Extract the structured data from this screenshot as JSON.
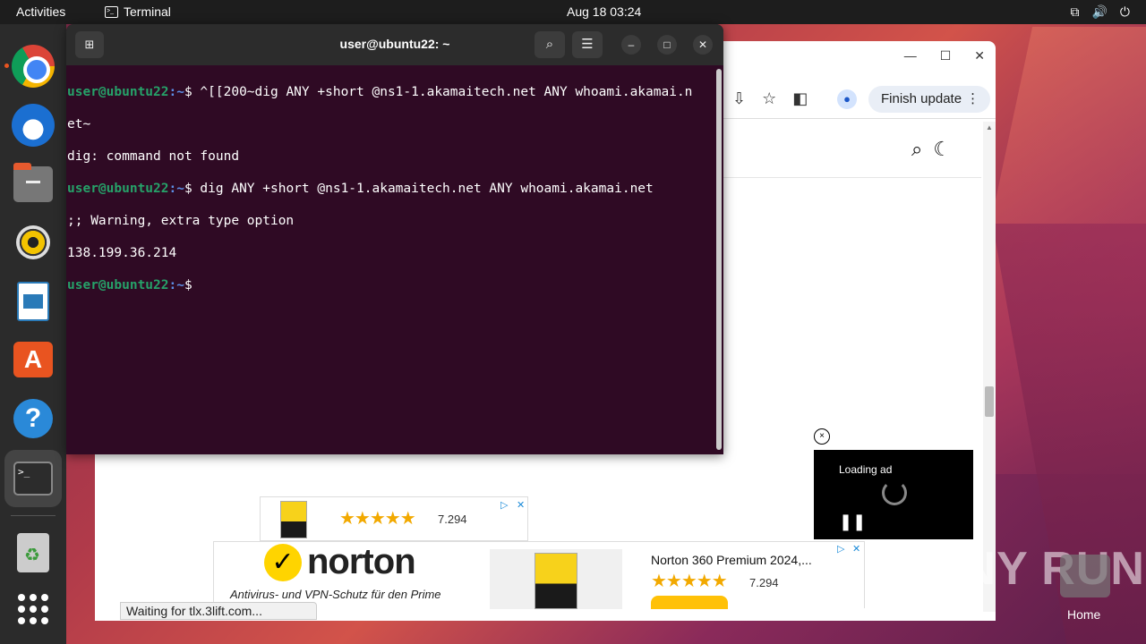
{
  "topbar": {
    "activities": "Activities",
    "app_name": "Terminal",
    "clock": "Aug 18  03:24",
    "tray": {
      "network": "⧉",
      "volume": "🔊",
      "power": "⏻"
    }
  },
  "dock": {
    "items": [
      "chrome",
      "thunderbird",
      "files",
      "rhythmbox",
      "libreoffice-writer",
      "app-center",
      "help",
      "terminal",
      "trash",
      "show-apps"
    ],
    "terminal_glyph": ">_"
  },
  "terminal": {
    "title": "user@ubuntu22: ~",
    "lines": [
      {
        "user": "user@ubuntu22",
        "path": ":~",
        "cmd": "$ ^[[200~dig ANY +short @ns1-1.akamaitech.net ANY whoami.akamai.n"
      },
      {
        "text": "et~"
      },
      {
        "text": "dig: command not found"
      },
      {
        "user": "user@ubuntu22",
        "path": ":~",
        "cmd": "$ dig ANY +short @ns1-1.akamaitech.net ANY whoami.akamai.net"
      },
      {
        "text": ";; Warning, extra type option"
      },
      {
        "text": "138.199.36.214"
      },
      {
        "user": "user@ubuntu22",
        "path": ":~",
        "cmd": "$ "
      }
    ]
  },
  "browser": {
    "finish_update": "Finish update",
    "status": "Waiting for tlx.3lift.com...",
    "video_ad": {
      "loading": "Loading ad"
    },
    "small_ad": {
      "rating": "7.294"
    },
    "large_ad": {
      "brand": "norton",
      "tagline": "Antivirus- und VPN-Schutz für den Prime",
      "product_title": "Norton 360 Premium 2024,...",
      "rating": "7.294"
    }
  },
  "watermark": {
    "text": "ANY RUN",
    "home_label": "Home"
  }
}
